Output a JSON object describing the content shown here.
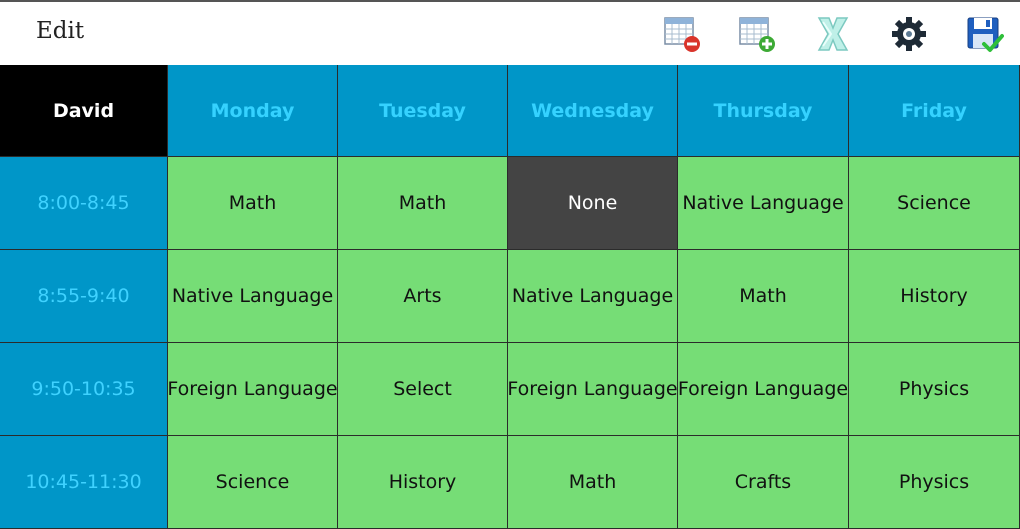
{
  "toolbar": {
    "title": "Edit",
    "icons": [
      "remove-table-icon",
      "add-table-icon",
      "clear-icon",
      "settings-icon",
      "save-icon"
    ]
  },
  "schedule": {
    "student": "David",
    "days": [
      "Monday",
      "Tuesday",
      "Wednesday",
      "Thursday",
      "Friday"
    ],
    "rows": [
      {
        "time": "8:00-8:45",
        "subjects": [
          "Math",
          "Math",
          "None",
          "Native Language",
          "Science"
        ]
      },
      {
        "time": "8:55-9:40",
        "subjects": [
          "Native Language",
          "Arts",
          "Native Language",
          "Math",
          "History"
        ]
      },
      {
        "time": "9:50-10:35",
        "subjects": [
          "Foreign Language",
          "Select",
          "Foreign Language",
          "Foreign Language",
          "Physics"
        ]
      },
      {
        "time": "10:45-11:30",
        "subjects": [
          "Science",
          "History",
          "Math",
          "Crafts",
          "Physics"
        ]
      }
    ],
    "selected_cell": {
      "row": 0,
      "day": 2
    }
  },
  "colors": {
    "header_bg": "#0096c8",
    "header_text": "#35d2ff",
    "corner_bg": "#000000",
    "subject_bg": "#76dd76",
    "selected_bg": "#444444"
  }
}
